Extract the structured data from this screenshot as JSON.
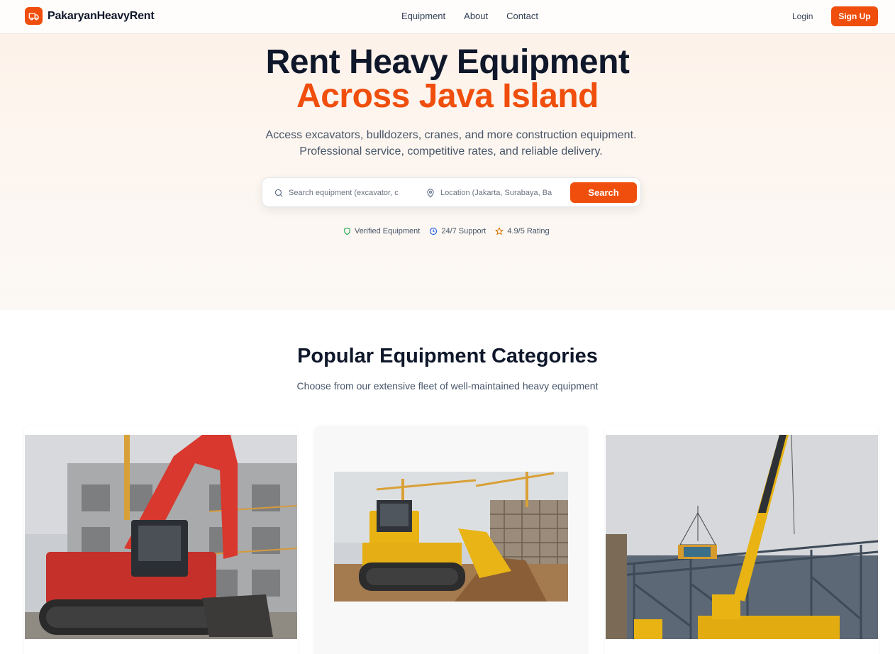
{
  "brand": {
    "name": "PakaryanHeavyRent",
    "icon": "truck-icon",
    "accent": "#f04e0c"
  },
  "nav": {
    "links": [
      "Equipment",
      "About",
      "Contact"
    ],
    "login": "Login",
    "signup": "Sign Up"
  },
  "hero": {
    "title_line1": "Rent Heavy Equipment",
    "title_line2": "Across Java Island",
    "subtitle": "Access excavators, bulldozers, cranes, and more construction equipment. Professional service, competitive rates, and reliable delivery.",
    "search": {
      "equipment_placeholder": "Search equipment (excavator, c",
      "location_placeholder": "Location (Jakarta, Surabaya, Ba",
      "button": "Search"
    },
    "badges": [
      {
        "label": "Verified Equipment",
        "icon": "shield-icon",
        "color": "#16a34a"
      },
      {
        "label": "24/7 Support",
        "icon": "clock-icon",
        "color": "#2563eb"
      },
      {
        "label": "4.9/5 Rating",
        "icon": "star-icon",
        "color": "#d97706"
      }
    ]
  },
  "categories": {
    "title": "Popular Equipment Categories",
    "subtitle": "Choose from our extensive fleet of well-maintained heavy equipment",
    "cards": [
      {
        "image": "excavator-photo"
      },
      {
        "image": "bulldozer-photo"
      },
      {
        "image": "crane-photo"
      }
    ]
  }
}
